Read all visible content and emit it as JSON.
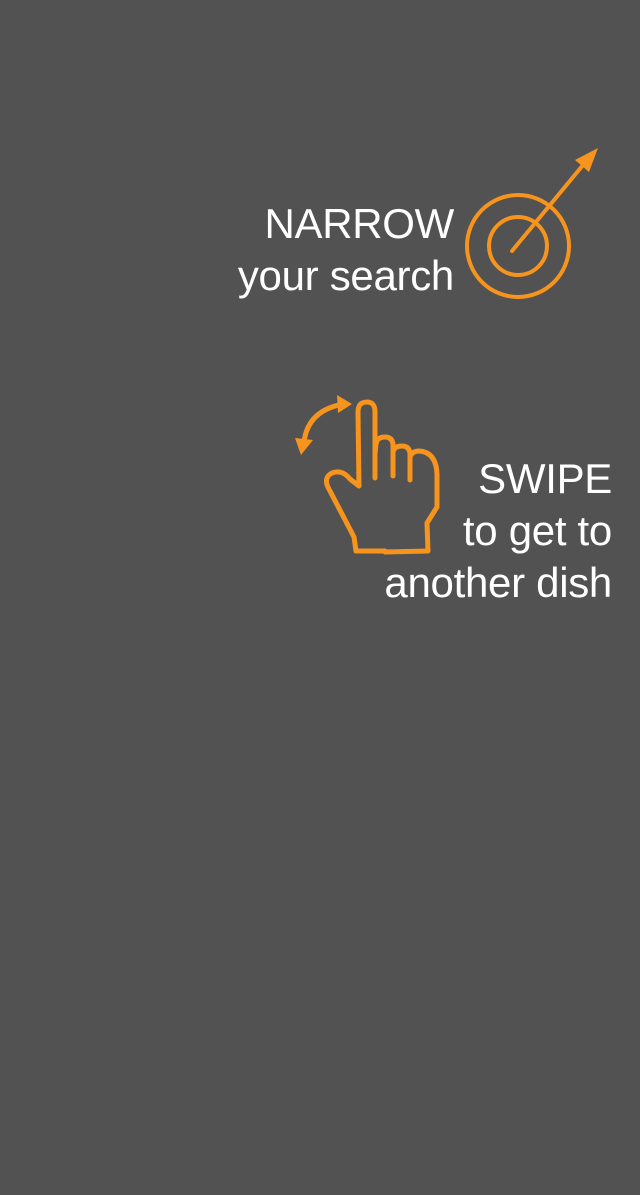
{
  "colors": {
    "background": "#525252",
    "accent": "#f7941d",
    "text": "#ffffff"
  },
  "hints": {
    "narrow": {
      "heading": "NARROW",
      "sub": "your search",
      "icon": "target-arrow-icon"
    },
    "swipe": {
      "heading": "SWIPE",
      "line2": "to get to",
      "line3": "another dish",
      "icon": "swipe-hand-icon"
    }
  }
}
